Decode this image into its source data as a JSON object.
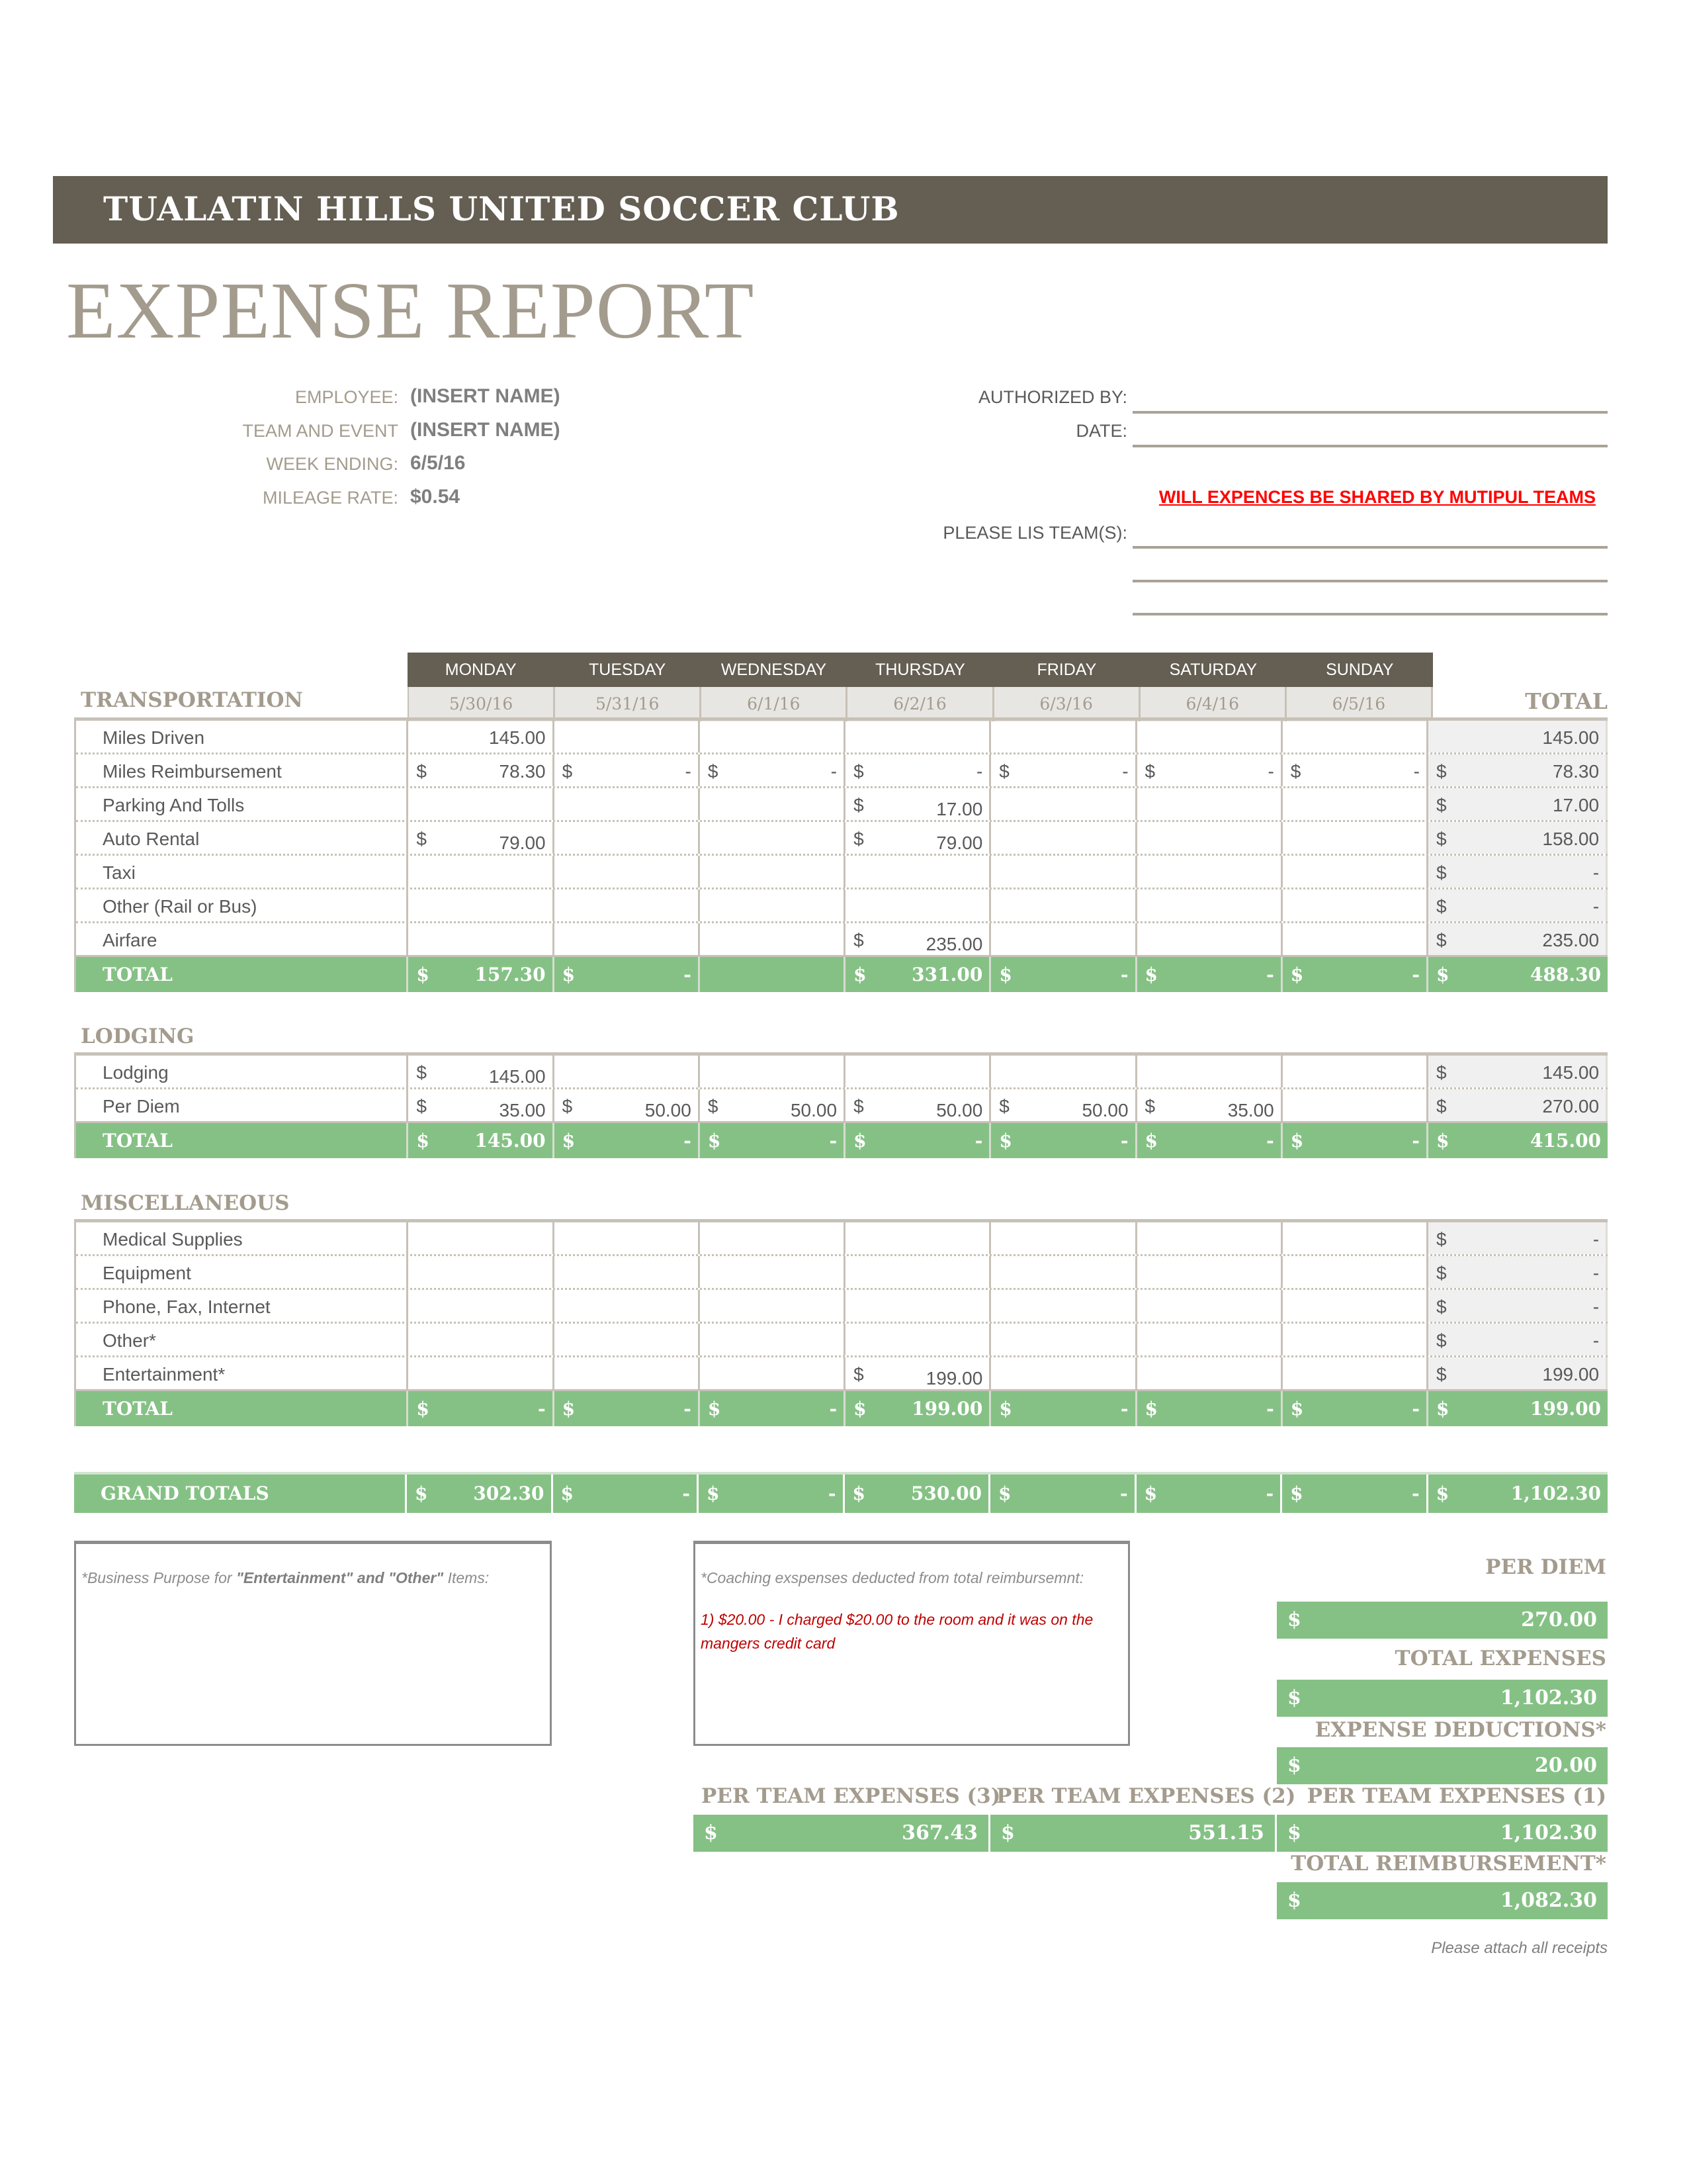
{
  "header": {
    "club_name": "TUALATIN HILLS UNITED SOCCER CLUB",
    "report_title": "EXPENSE REPORT"
  },
  "info": {
    "employee_label": "EMPLOYEE:",
    "employee_value": "(INSERT NAME)",
    "team_label": "TEAM AND EVENT",
    "team_value": "(INSERT NAME)",
    "week_label": "WEEK ENDING:",
    "week_value": "6/5/16",
    "mileage_label": "MILEAGE RATE:",
    "mileage_value": "$0.54",
    "authorized_label": "AUTHORIZED BY:",
    "date_label": "DATE:",
    "shared_warning": "WILL EXPENCES BE SHARED BY MUTIPUL TEAMS",
    "teams_label": "PLEASE LIS TEAM(S):"
  },
  "days": [
    "MONDAY",
    "TUESDAY",
    "WEDNESDAY",
    "THURSDAY",
    "FRIDAY",
    "SATURDAY",
    "SUNDAY"
  ],
  "dates": [
    "5/30/16",
    "5/31/16",
    "6/1/16",
    "6/2/16",
    "6/3/16",
    "6/4/16",
    "6/5/16"
  ],
  "total_header": "TOTAL",
  "transportation": {
    "title": "TRANSPORTATION",
    "rows": [
      {
        "label": "Miles Driven",
        "cells": [
          [
            "",
            "145.00"
          ],
          null,
          null,
          null,
          null,
          null,
          null
        ],
        "total": [
          "",
          "145.00"
        ]
      },
      {
        "label": "Miles Reimbursement",
        "cells": [
          [
            "$",
            "78.30"
          ],
          [
            "$",
            "-"
          ],
          [
            "$",
            "-"
          ],
          [
            "$",
            "-"
          ],
          [
            "$",
            "-"
          ],
          [
            "$",
            "-"
          ],
          [
            "$",
            "-"
          ]
        ],
        "total": [
          "$",
          "78.30"
        ]
      },
      {
        "label": "Parking And Tolls",
        "cells": [
          null,
          null,
          null,
          [
            "$",
            "17.00"
          ],
          null,
          null,
          null
        ],
        "total": [
          "$",
          "17.00"
        ]
      },
      {
        "label": "Auto Rental",
        "cells": [
          [
            "$",
            "79.00"
          ],
          null,
          null,
          [
            "$",
            "79.00"
          ],
          null,
          null,
          null
        ],
        "total": [
          "$",
          "158.00"
        ]
      },
      {
        "label": "Taxi",
        "cells": [
          null,
          null,
          null,
          null,
          null,
          null,
          null
        ],
        "total": [
          "$",
          "-"
        ]
      },
      {
        "label": "Other (Rail or Bus)",
        "cells": [
          null,
          null,
          null,
          null,
          null,
          null,
          null
        ],
        "total": [
          "$",
          "-"
        ]
      },
      {
        "label": "Airfare",
        "cells": [
          null,
          null,
          null,
          [
            "$",
            "235.00"
          ],
          null,
          null,
          null
        ],
        "total": [
          "$",
          "235.00"
        ]
      }
    ],
    "total_row": {
      "label": "TOTAL",
      "cells": [
        [
          "$",
          "157.30"
        ],
        [
          "$",
          "-"
        ],
        null,
        [
          "$",
          "331.00"
        ],
        [
          "$",
          "-"
        ],
        [
          "$",
          "-"
        ],
        [
          "$",
          "-"
        ]
      ],
      "total": [
        "$",
        "488.30"
      ]
    }
  },
  "lodging": {
    "title": "LODGING",
    "rows": [
      {
        "label": "Lodging",
        "cells": [
          [
            "$",
            "145.00"
          ],
          null,
          null,
          null,
          null,
          null,
          null
        ],
        "total": [
          "$",
          "145.00"
        ]
      },
      {
        "label": "Per Diem",
        "cells": [
          [
            "$",
            "35.00"
          ],
          [
            "$",
            "50.00"
          ],
          [
            "$",
            "50.00"
          ],
          [
            "$",
            "50.00"
          ],
          [
            "$",
            "50.00"
          ],
          [
            "$",
            "35.00"
          ],
          null
        ],
        "total": [
          "$",
          "270.00"
        ]
      }
    ],
    "total_row": {
      "label": "TOTAL",
      "cells": [
        [
          "$",
          "145.00"
        ],
        [
          "$",
          "-"
        ],
        [
          "$",
          "-"
        ],
        [
          "$",
          "-"
        ],
        [
          "$",
          "-"
        ],
        [
          "$",
          "-"
        ],
        [
          "$",
          "-"
        ]
      ],
      "total": [
        "$",
        "415.00"
      ]
    }
  },
  "miscellaneous": {
    "title": "MISCELLANEOUS",
    "rows": [
      {
        "label": "Medical Supplies",
        "cells": [
          null,
          null,
          null,
          null,
          null,
          null,
          null
        ],
        "total": [
          "$",
          "-"
        ]
      },
      {
        "label": "Equipment",
        "cells": [
          null,
          null,
          null,
          null,
          null,
          null,
          null
        ],
        "total": [
          "$",
          "-"
        ]
      },
      {
        "label": "Phone, Fax, Internet",
        "cells": [
          null,
          null,
          null,
          null,
          null,
          null,
          null
        ],
        "total": [
          "$",
          "-"
        ]
      },
      {
        "label": "Other*",
        "cells": [
          null,
          null,
          null,
          null,
          null,
          null,
          null
        ],
        "total": [
          "$",
          "-"
        ]
      },
      {
        "label": "Entertainment*",
        "cells": [
          null,
          null,
          null,
          [
            "$",
            "199.00"
          ],
          null,
          null,
          null
        ],
        "total": [
          "$",
          "199.00"
        ]
      }
    ],
    "total_row": {
      "label": "TOTAL",
      "cells": [
        [
          "$",
          "-"
        ],
        [
          "$",
          "-"
        ],
        [
          "$",
          "-"
        ],
        [
          "$",
          "199.00"
        ],
        [
          "$",
          "-"
        ],
        [
          "$",
          "-"
        ],
        [
          "$",
          "-"
        ]
      ],
      "total": [
        "$",
        "199.00"
      ]
    }
  },
  "grand_totals": {
    "label": "GRAND TOTALS",
    "cells": [
      [
        "$",
        "302.30"
      ],
      [
        "$",
        "-"
      ],
      [
        "$",
        "-"
      ],
      [
        "$",
        "530.00"
      ],
      [
        "$",
        "-"
      ],
      [
        "$",
        "-"
      ],
      [
        "$",
        "-"
      ]
    ],
    "total": [
      "$",
      "1,102.30"
    ]
  },
  "notes": {
    "business_purpose_prefix": "*Business Purpose for ",
    "business_purpose_bold": "\"Entertainment\" and \"Other\"",
    "business_purpose_suffix": " Items:",
    "coaching_head": "*Coaching exspenses deducted from total reimbursemnt:",
    "coaching_note": "1) $20.00 - I charged $20.00 to the room and it was on the mangers credit card"
  },
  "summary": {
    "per_diem_label": "PER DIEM",
    "per_diem_value": "270.00",
    "total_expenses_label": "TOTAL EXPENSES",
    "total_expenses_value": "1,102.30",
    "deductions_label": "EXPENSE DEDUCTIONS*",
    "deductions_value": "20.00",
    "team3_label": "PER TEAM EXPENSES (3)",
    "team3_value": "367.43",
    "team2_label": "PER TEAM EXPENSES (2)",
    "team2_value": "551.15",
    "team1_label": "PER TEAM EXPENSES (1)",
    "team1_value": "1,102.30",
    "reimbursement_label": "TOTAL REIMBURSEMENT*",
    "reimbursement_value": "1,082.30",
    "currency": "$",
    "receipts_note": "Please attach all receipts"
  },
  "colors": {
    "banner": "#645e53",
    "accent_text": "#a39b8d",
    "total_green": "#85c185",
    "warning_red": "#ff0000",
    "note_red": "#c00000"
  }
}
